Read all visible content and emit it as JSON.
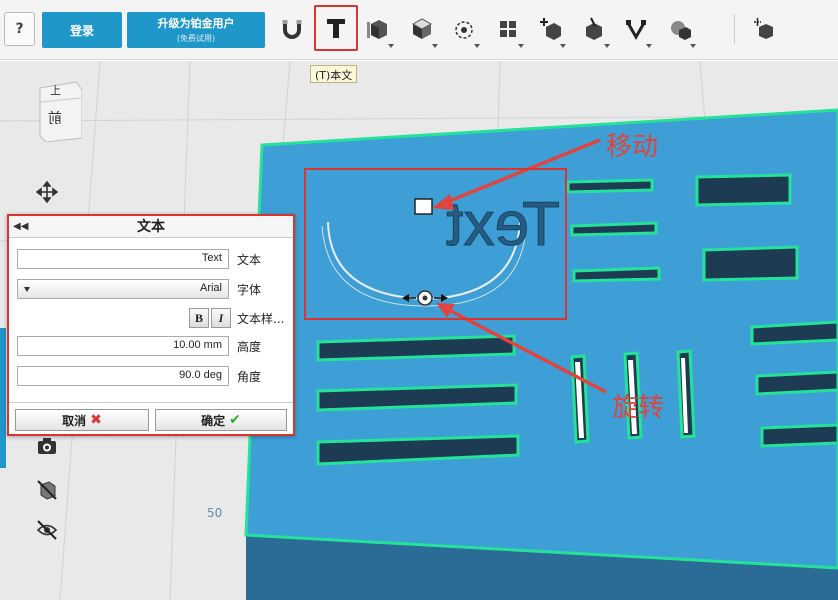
{
  "toolbar": {
    "help_label": "?",
    "login_label": "登录",
    "upgrade_title": "升级为铂金用户",
    "upgrade_subtitle": "(免费试用)",
    "tools": [
      "magnet-icon",
      "text-tool-icon",
      "ruler-box-icon",
      "box-icon",
      "sphere-snap-icon",
      "group-icon",
      "add-point-icon",
      "cube-solid-icon",
      "pen-vector-icon",
      "shape-icon",
      "add-component-icon"
    ],
    "tooltip": "(T)本文"
  },
  "viewport": {
    "nav_cube_top_label": "上",
    "nav_cube_front_label": "前",
    "grid_label": "50",
    "model_text": "Text",
    "annotation_move": "移动",
    "annotation_rotate": "旋转",
    "plate_color": "#3d9fd5",
    "outline_color": "#25e29a"
  },
  "panel": {
    "title": "文本",
    "text_label": "文本",
    "text_value": "Text",
    "font_label": "字体",
    "font_value": "Arial",
    "style_label": "文本样...",
    "bold_label": "B",
    "italic_label": "I",
    "height_label": "高度",
    "height_value": "10.00 mm",
    "angle_label": "角度",
    "angle_value": "90.0 deg",
    "cancel_label": "取消",
    "ok_label": "确定"
  },
  "colors": {
    "accent": "#1f97c8",
    "highlight_red": "#d83530"
  }
}
